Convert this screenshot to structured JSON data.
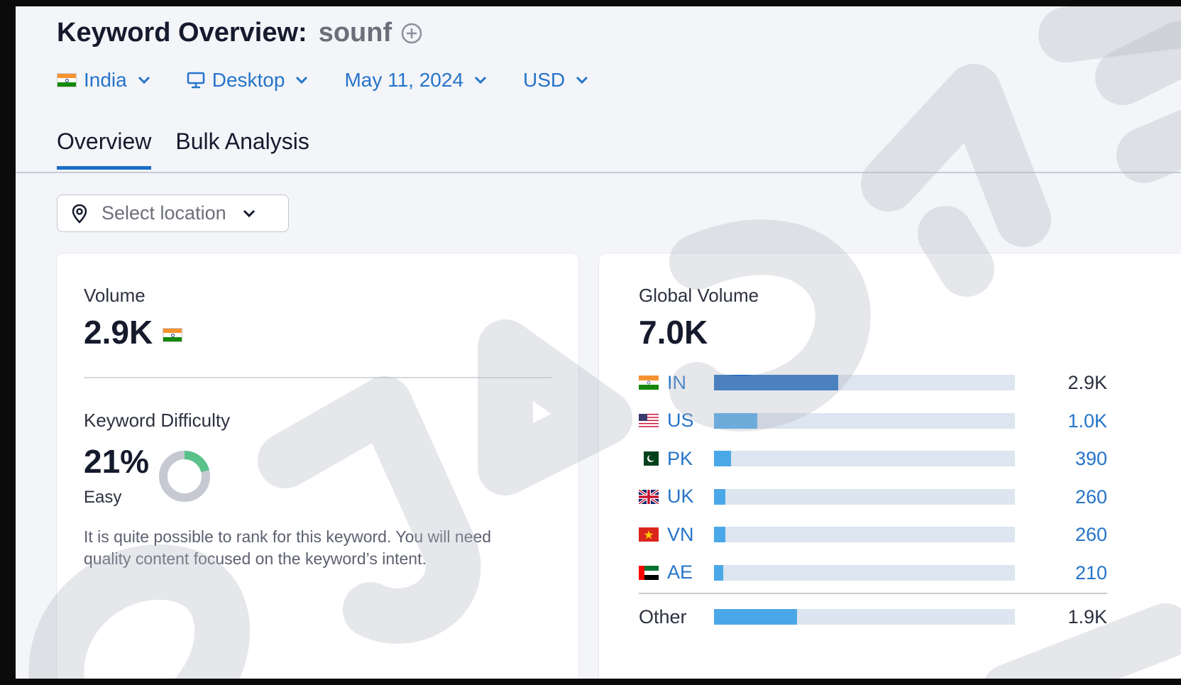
{
  "header": {
    "title": "Keyword Overview:",
    "keyword": "sounf"
  },
  "filters": {
    "country": "India",
    "device": "Desktop",
    "date": "May 11, 2024",
    "currency": "USD"
  },
  "tabs": [
    {
      "label": "Overview",
      "active": true
    },
    {
      "label": "Bulk Analysis",
      "active": false
    }
  ],
  "location": {
    "placeholder": "Select location"
  },
  "volume": {
    "label": "Volume",
    "value": "2.9K"
  },
  "difficulty": {
    "label": "Keyword Difficulty",
    "value": "21%",
    "level": "Easy",
    "percent": 21,
    "description": "It is quite possible to rank for this keyword. You will need quality content focused on the keyword’s intent."
  },
  "global_volume": {
    "label": "Global Volume",
    "value": "7.0K",
    "countries": [
      {
        "code": "IN",
        "value": "2.9K",
        "share": 0.413,
        "flag": "india-flag-icon"
      },
      {
        "code": "US",
        "value": "1.0K",
        "share": 0.143,
        "flag": "us-flag-icon"
      },
      {
        "code": "PK",
        "value": "390",
        "share": 0.056,
        "flag": "pakistan-flag-icon"
      },
      {
        "code": "UK",
        "value": "260",
        "share": 0.037,
        "flag": "uk-flag-icon"
      },
      {
        "code": "VN",
        "value": "260",
        "share": 0.037,
        "flag": "vietnam-flag-icon"
      },
      {
        "code": "AE",
        "value": "210",
        "share": 0.03,
        "flag": "uae-flag-icon"
      }
    ],
    "other": {
      "label": "Other",
      "value": "1.9K",
      "share": 0.277
    }
  },
  "colors": {
    "accent": "#2574c9",
    "bar_primary": "#1a68bf",
    "bar_secondary": "#4ba8e8",
    "bar_track": "#dce5f0",
    "difficulty_green": "#59c18a"
  }
}
